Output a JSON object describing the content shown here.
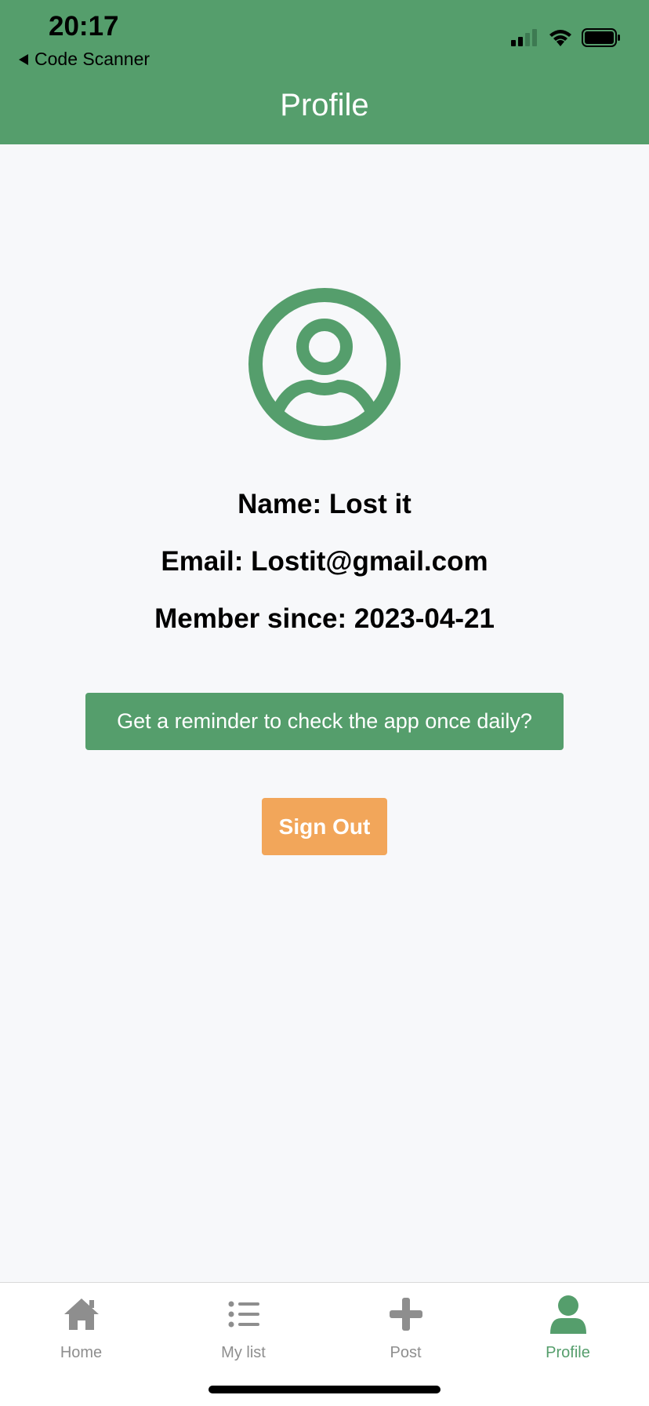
{
  "status_bar": {
    "time": "20:17",
    "back_label": "Code Scanner"
  },
  "header": {
    "title": "Profile"
  },
  "profile": {
    "name_line": "Name: Lost it",
    "email_line": "Email: Lostit@gmail.com",
    "member_line": "Member since: 2023-04-21"
  },
  "actions": {
    "reminder_label": "Get a reminder to check the app once daily?",
    "signout_label": "Sign Out"
  },
  "tabs": [
    {
      "label": "Home",
      "icon": "home-icon",
      "active": false
    },
    {
      "label": "My list",
      "icon": "list-icon",
      "active": false
    },
    {
      "label": "Post",
      "icon": "plus-icon",
      "active": false
    },
    {
      "label": "Profile",
      "icon": "person-icon",
      "active": true
    }
  ],
  "colors": {
    "primary_green": "#559e6c",
    "signout_orange": "#f2a65a",
    "inactive_tab": "#8e8e8e",
    "background": "#f7f8fa"
  }
}
